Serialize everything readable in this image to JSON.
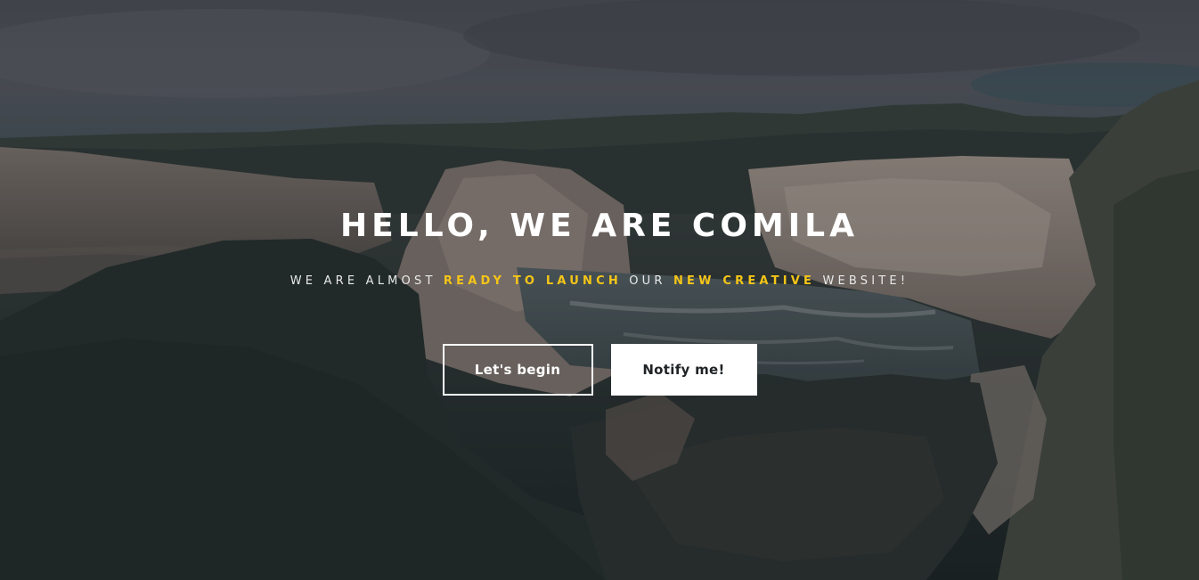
{
  "hero": {
    "headline": "HELLO, WE ARE COMILA",
    "tagline": {
      "part1": "WE ARE ALMOST ",
      "highlight1": "READY TO LAUNCH",
      "part2": " OUR ",
      "highlight2": "NEW CREATIVE",
      "part3": " WEBSITE!"
    },
    "buttons": {
      "primary_label": "Let's begin",
      "secondary_label": "Notify me!"
    }
  },
  "colors": {
    "accent": "#f5c518",
    "text": "#ffffff",
    "button_fill": "#ffffff",
    "button_text": "#1f2326"
  }
}
